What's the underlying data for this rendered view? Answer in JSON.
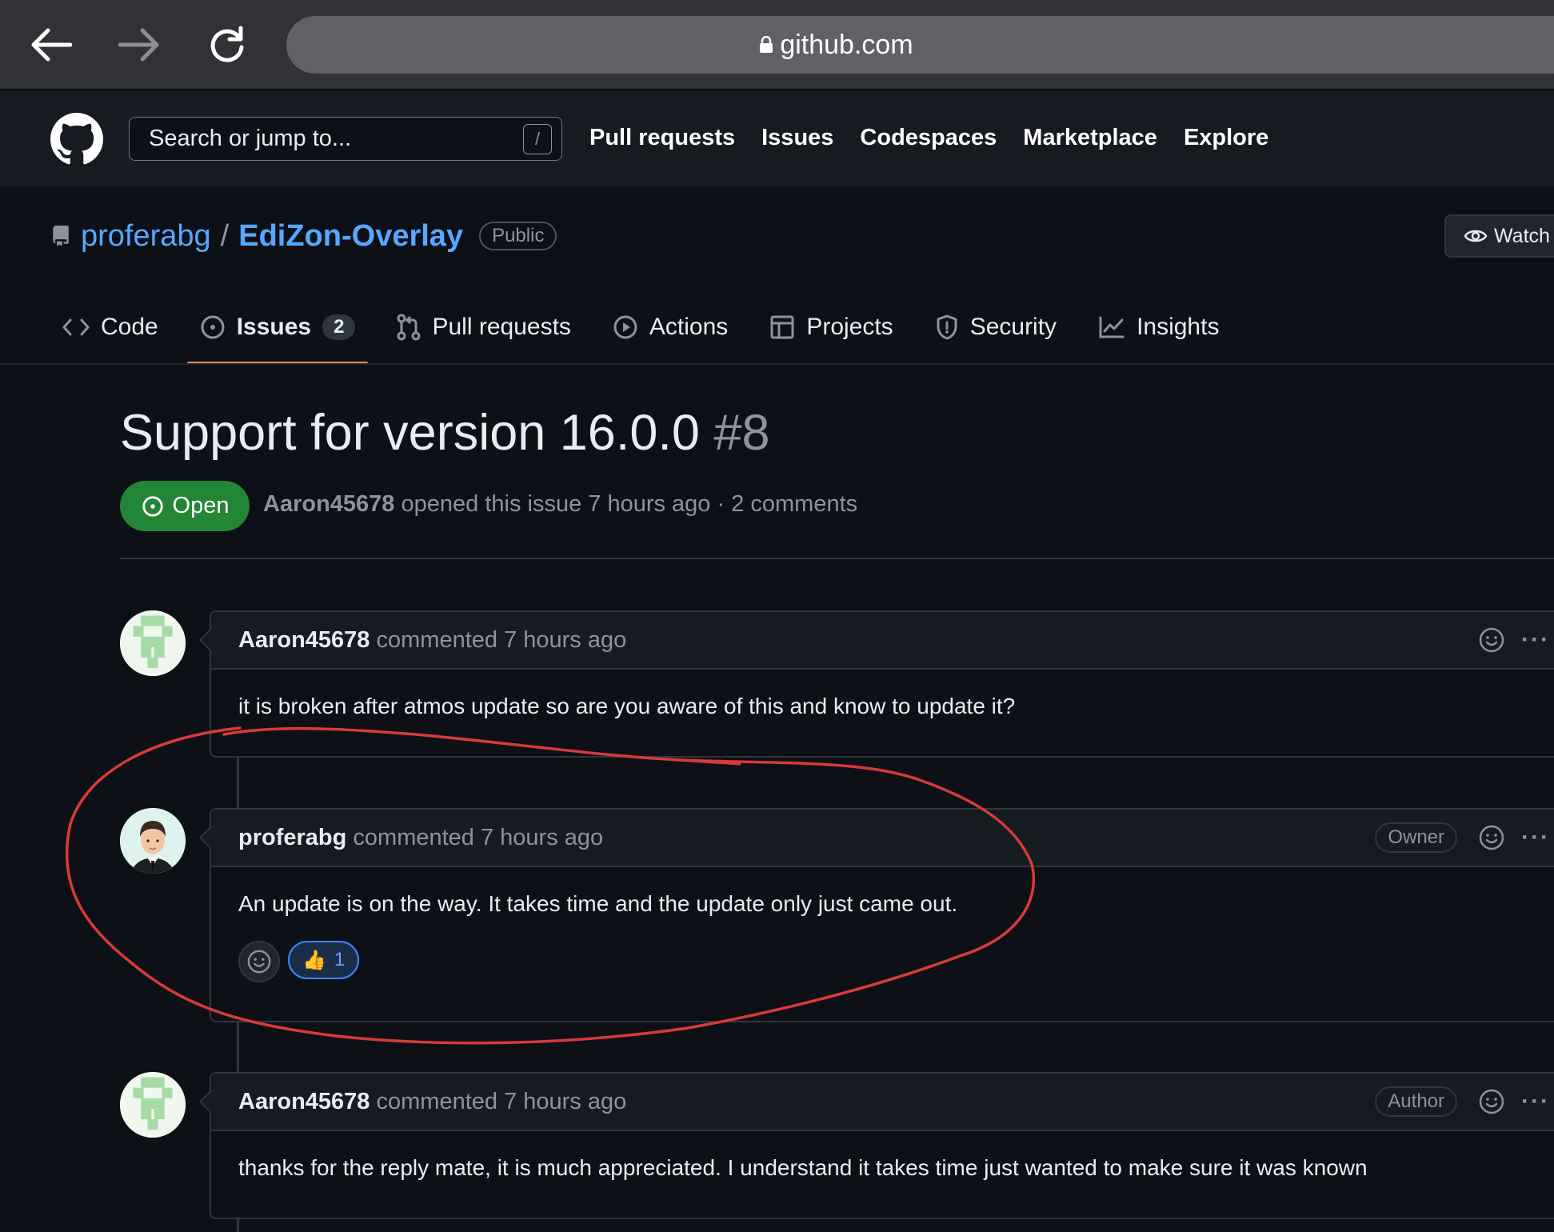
{
  "browser": {
    "url": "github.com",
    "icons": [
      "back-arrow-icon",
      "forward-arrow-icon",
      "reload-icon",
      "lock-icon"
    ]
  },
  "header": {
    "search_placeholder": "Search or jump to...",
    "search_key": "/",
    "nav": [
      "Pull requests",
      "Issues",
      "Codespaces",
      "Marketplace",
      "Explore"
    ]
  },
  "repo": {
    "owner": "proferabg",
    "separator": "/",
    "name": "EdiZon-Overlay",
    "visibility": "Public",
    "watch_label": "Watch"
  },
  "tabs": [
    {
      "label": "Code",
      "icon": "code-icon"
    },
    {
      "label": "Issues",
      "icon": "issue-icon",
      "count": "2"
    },
    {
      "label": "Pull requests",
      "icon": "pull-request-icon"
    },
    {
      "label": "Actions",
      "icon": "play-icon"
    },
    {
      "label": "Projects",
      "icon": "table-icon"
    },
    {
      "label": "Security",
      "icon": "shield-icon"
    },
    {
      "label": "Insights",
      "icon": "graph-icon"
    }
  ],
  "issue": {
    "title": "Support for version 16.0.0",
    "number": "#8",
    "state": "Open",
    "author": "Aaron45678",
    "meta": "opened this issue 7 hours ago · 2 comments"
  },
  "comments": [
    {
      "author": "Aaron45678",
      "action": "commented 7 hours ago",
      "body": "it is broken after atmos update so are you aware of this and know to update it?"
    },
    {
      "author": "proferabg",
      "action": "commented 7 hours ago",
      "role": "Owner",
      "body": "An update is on the way. It takes time and the update only just came out.",
      "reaction_emoji": "👍",
      "reaction_count": "1"
    },
    {
      "author": "Aaron45678",
      "action": "commented 7 hours ago",
      "role": "Author",
      "body": "thanks for the reply mate, it is much appreciated. I understand it takes time just wanted to make sure it was known"
    }
  ],
  "colors": {
    "background": "#0d1117",
    "link": "#58a6ff",
    "open_green": "#238636",
    "tab_underline": "#f78166",
    "annotation_red": "#d83a3a"
  }
}
